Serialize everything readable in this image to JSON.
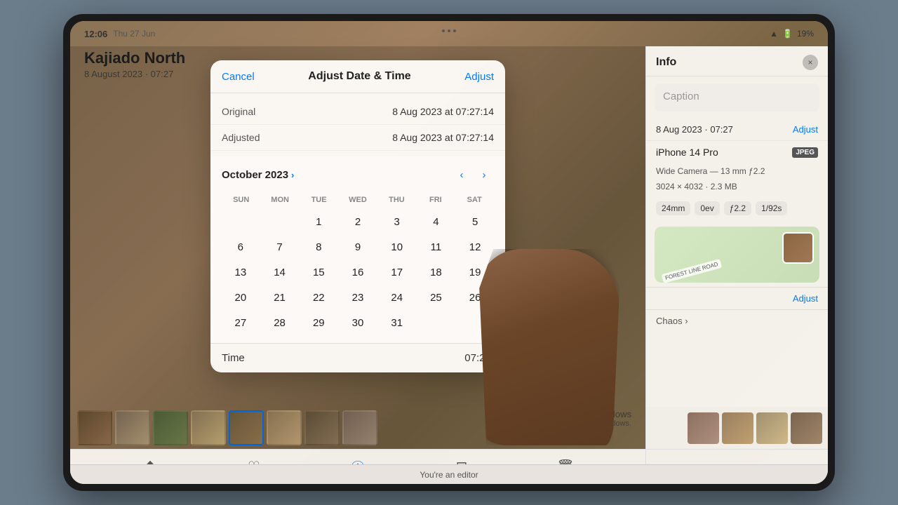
{
  "status_bar": {
    "time": "12:06",
    "day": "Thu 27 Jun",
    "wifi": "WiFi",
    "battery": "19%"
  },
  "photo_title": {
    "main": "Kajiado North",
    "sub": "8 August 2023 · 07:27"
  },
  "info_panel": {
    "title": "Info",
    "close_label": "×",
    "caption_placeholder": "Caption",
    "date_label": "8 Aug 2023 · 07:27",
    "adjust_label": "Adjust",
    "device": "iPhone 14 Pro",
    "badge": "JPEG",
    "camera_info": "Wide Camera — 13 mm ƒ2.2",
    "resolution": "3024 × 4032 · 2.3 MB",
    "tags": [
      "24mm",
      "0ev",
      "ƒ2.2",
      "1/92s"
    ],
    "map_road": "FOREST LINE ROAD",
    "albums_label": "Chaos ›",
    "adjust2_label": "Adjust"
  },
  "modal": {
    "cancel_label": "Cancel",
    "title": "Adjust Date & Time",
    "adjust_label": "Adjust",
    "original_label": "Original",
    "original_value": "8 Aug 2023 at 07:27:14",
    "adjusted_label": "Adjusted",
    "adjusted_value": "8 Aug 2023 at 07:27:14",
    "month": "October 2023",
    "days_header": [
      "SUN",
      "MON",
      "TUE",
      "WED",
      "THU",
      "FRI",
      "SAT"
    ],
    "days": [
      [
        "",
        "",
        "1",
        "2",
        "3",
        "4",
        "5"
      ],
      [
        "6",
        "7",
        "8",
        "9",
        "10",
        "11",
        "12"
      ],
      [
        "13",
        "14",
        "15",
        "16",
        "17",
        "18",
        "19"
      ],
      [
        "20",
        "21",
        "22",
        "23",
        "24",
        "25",
        "26"
      ],
      [
        "27",
        "28",
        "29",
        "30",
        "31",
        "",
        ""
      ]
    ],
    "time_label": "Time",
    "time_value": "07:2..."
  },
  "toolbar": {
    "share": "⬆",
    "heart": "♡",
    "info": "ⓘ",
    "sliders": "⊟",
    "trash": "🗑"
  },
  "bottom_status": {
    "text": "You're an editor"
  },
  "windows": {
    "activate_title": "Activate Windows",
    "activate_sub": "Go to Settings to activate Windows."
  }
}
